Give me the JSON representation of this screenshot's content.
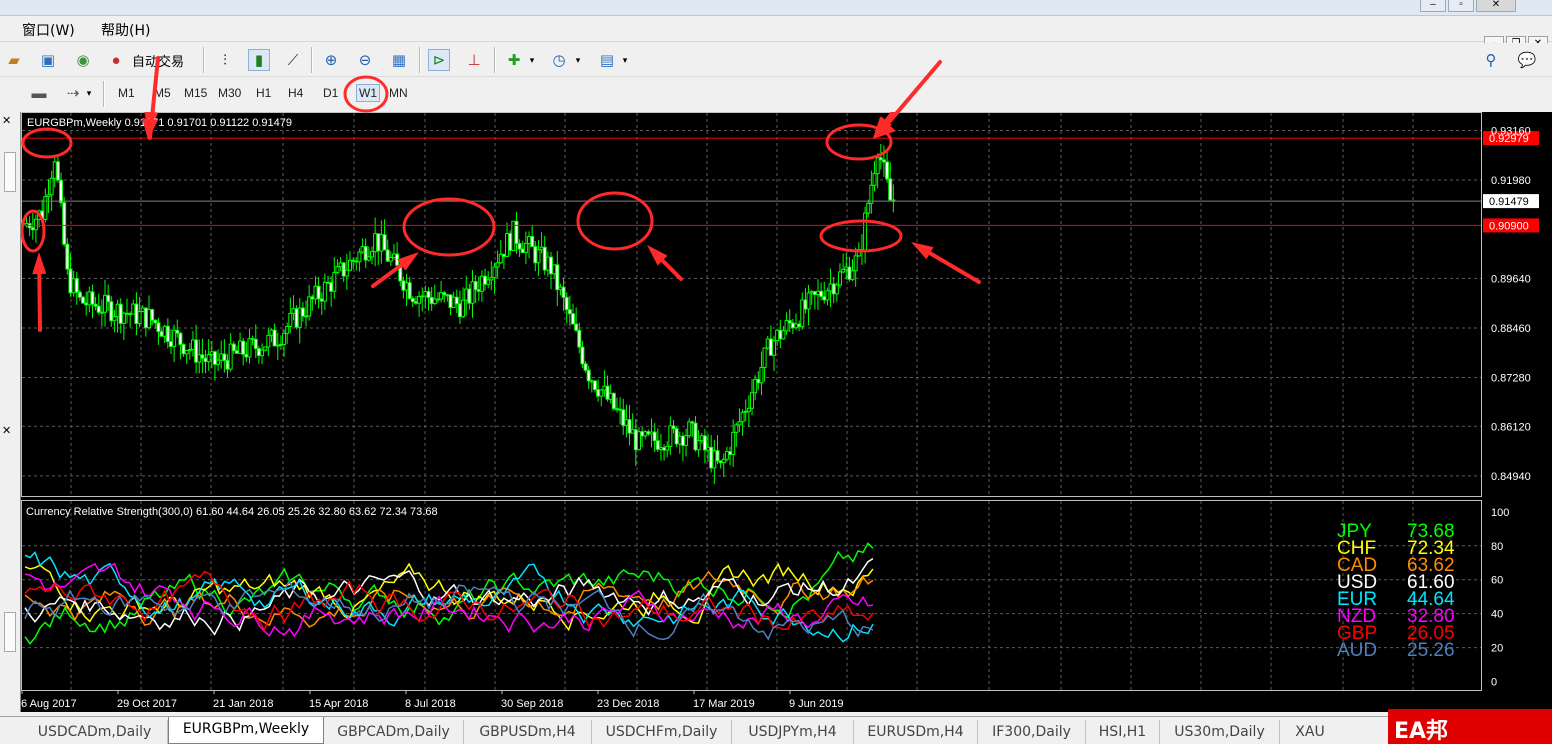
{
  "menu": {
    "window": "窗口(W)",
    "help": "帮助(H)"
  },
  "toolbar": {
    "auto_trading": "自动交易"
  },
  "timeframes": [
    "M1",
    "M5",
    "M15",
    "M30",
    "H1",
    "H4",
    "D1",
    "W1",
    "MN"
  ],
  "active_timeframe": "W1",
  "chart": {
    "header": "EURGBPm,Weekly  0.91271 0.91701 0.91122 0.91479",
    "price_labels": [
      "0.93160",
      "0.91980",
      "0.89640",
      "0.88460",
      "0.87280",
      "0.86120",
      "0.84940"
    ],
    "price_levels": [
      0.9316,
      0.9198,
      0.8964,
      0.8846,
      0.8728,
      0.8612,
      0.8494
    ],
    "marked_levels": [
      {
        "label": "0.92979",
        "value": 0.92979,
        "color": "#ff0000"
      },
      {
        "label": "0.90900",
        "value": 0.909,
        "color": "#ff0000"
      }
    ],
    "current_price": {
      "label": "0.91479",
      "value": 0.91479
    },
    "date_labels": [
      "6 Aug 2017",
      "29 Oct 2017",
      "21 Jan 2018",
      "15 Apr 2018",
      "8 Jul 2018",
      "30 Sep 2018",
      "23 Dec 2018",
      "17 Mar 2019",
      "9 Jun 2019"
    ],
    "candle_color": "#00ff00",
    "grid_color": "#5a5a5a"
  },
  "indicator": {
    "header": "Currency Relative Strength(300,0) 61.60 44.64 26.05 25.26 32.80 63.62 72.34 73.68",
    "scale_labels": [
      "100",
      "80",
      "60",
      "40",
      "20",
      "0"
    ],
    "scale_levels": [
      100,
      80,
      60,
      40,
      20,
      0
    ],
    "legend": [
      {
        "name": "JPY",
        "value": "73.68",
        "color": "#00ff00"
      },
      {
        "name": "CHF",
        "value": "72.34",
        "color": "#ffff00"
      },
      {
        "name": "CAD",
        "value": "63.62",
        "color": "#ff8c00"
      },
      {
        "name": "USD",
        "value": "61.60",
        "color": "#ffffff"
      },
      {
        "name": "EUR",
        "value": "44.64",
        "color": "#00e5ff"
      },
      {
        "name": "NZD",
        "value": "32.80",
        "color": "#ff00ff"
      },
      {
        "name": "GBP",
        "value": "26.05",
        "color": "#ff0000"
      },
      {
        "name": "AUD",
        "value": "25.26",
        "color": "#4f7fbf"
      }
    ]
  },
  "tabs": [
    "USDCADm,Daily",
    "EURGBPm,Weekly",
    "GBPCADm,Daily",
    "GBPUSDm,H4",
    "USDCHFm,Daily",
    "USDJPYm,H4",
    "EURUSDm,H4",
    "IF300,Daily",
    "HSI,H1",
    "US30m,Daily",
    "XAU"
  ],
  "active_tab": "EURGBPm,Weekly",
  "watermark": "EA邦 www.eabang.com",
  "annotation_color": "#ff2a2a"
}
